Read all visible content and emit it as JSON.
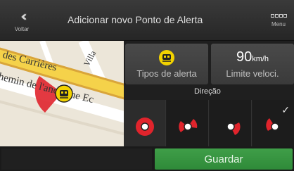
{
  "header": {
    "back_label": "Voltar",
    "title": "Adicionar novo Ponto de Alerta",
    "menu_label": "Menu"
  },
  "map": {
    "streets": [
      "des Carrières",
      "hemin de l'ancienne Ec",
      "Villa"
    ]
  },
  "alert_types": {
    "label": "Tipos de alerta",
    "icon": "railway-crossing-icon"
  },
  "speed_limit": {
    "value": "90",
    "unit": "km/h",
    "label": "Limite veloci."
  },
  "direction": {
    "label": "Direção",
    "options": [
      "direction-all",
      "direction-forward",
      "direction-backward",
      "direction-selected"
    ],
    "selected_index": 3
  },
  "actions": {
    "save_label": "Guardar"
  },
  "colors": {
    "accent_green": "#3f9e48",
    "marker_red": "#e0242c",
    "alert_yellow": "#f2d200"
  }
}
